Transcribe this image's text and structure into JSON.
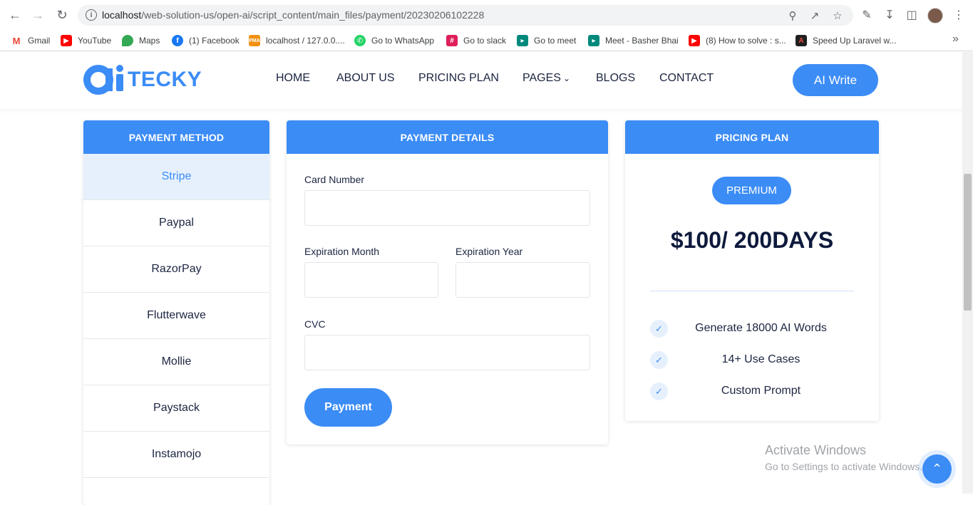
{
  "browser": {
    "url_host": "localhost",
    "url_path": "/web-solution-us/open-ai/script_content/main_files/payment/20230206102228",
    "bookmarks": [
      {
        "label": "Gmail",
        "icon": "gmail-icon",
        "color": "#ea4335"
      },
      {
        "label": "YouTube",
        "icon": "youtube-icon",
        "color": "#ff0000"
      },
      {
        "label": "Maps",
        "icon": "maps-icon",
        "color": "#34a853"
      },
      {
        "label": "(1) Facebook",
        "icon": "facebook-icon",
        "color": "#1877f2"
      },
      {
        "label": "localhost / 127.0.0....",
        "icon": "phpmyadmin-icon",
        "color": "#f29111"
      },
      {
        "label": "Go to WhatsApp",
        "icon": "whatsapp-icon",
        "color": "#25d366"
      },
      {
        "label": "Go to slack",
        "icon": "slack-icon",
        "color": "#e01e5a"
      },
      {
        "label": "Go to meet",
        "icon": "meet-icon",
        "color": "#00897b"
      },
      {
        "label": "Meet - Basher Bhai",
        "icon": "meet-icon",
        "color": "#00897b"
      },
      {
        "label": "(8) How to solve : s...",
        "icon": "youtube-icon",
        "color": "#ff0000"
      },
      {
        "label": "Speed Up Laravel w...",
        "icon": "laravel-icon",
        "color": "#c0392b"
      }
    ]
  },
  "site": {
    "logo_text": "TECKY",
    "nav": [
      "HOME",
      "ABOUT US",
      "PRICING PLAN",
      "PAGES",
      "BLOGS",
      "CONTACT"
    ],
    "cta": "AI Write"
  },
  "payment_method": {
    "title": "PAYMENT METHOD",
    "items": [
      "Stripe",
      "Paypal",
      "RazorPay",
      "Flutterwave",
      "Mollie",
      "Paystack",
      "Instamojo"
    ],
    "active": "Stripe"
  },
  "payment_details": {
    "title": "PAYMENT DETAILS",
    "card_number_label": "Card Number",
    "card_number_value": "",
    "exp_month_label": "Expiration Month",
    "exp_month_value": "",
    "exp_year_label": "Expiration Year",
    "exp_year_value": "",
    "cvc_label": "CVC",
    "cvc_value": "",
    "submit_label": "Payment"
  },
  "pricing_plan": {
    "title": "PRICING PLAN",
    "badge": "PREMIUM",
    "price": "$100/ 200DAYS",
    "features": [
      "Generate 18000 AI Words",
      "14+ Use Cases",
      "Custom Prompt"
    ]
  },
  "os": {
    "watermark_title": "Activate Windows",
    "watermark_sub": "Go to Settings to activate Windows."
  },
  "colors": {
    "accent": "#3b8cf5",
    "heading": "#0e1a3c"
  }
}
